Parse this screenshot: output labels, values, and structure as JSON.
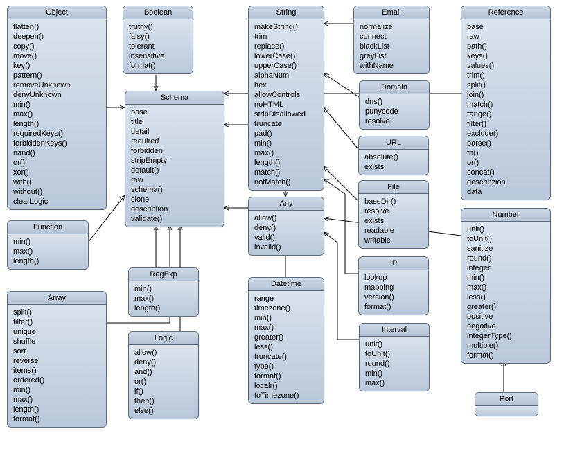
{
  "boxes": {
    "object": {
      "title": "Object",
      "items": [
        "flatten()",
        "deepen()",
        "copy()",
        "move()",
        "key()",
        "pattern()",
        "removeUnknown",
        "denyUnknown",
        "min()",
        "max()",
        "length()",
        "requiredKeys()",
        "forbiddenKeys()",
        "nand()",
        "or()",
        "xor()",
        "with()",
        "without()",
        "clearLogic"
      ]
    },
    "function": {
      "title": "Function",
      "items": [
        "min()",
        "max()",
        "length()"
      ]
    },
    "array": {
      "title": "Array",
      "items": [
        "split()",
        "filter()",
        "unique",
        "shuffle",
        "sort",
        "reverse",
        "items()",
        "ordered()",
        "min()",
        "max()",
        "length()",
        "format()"
      ]
    },
    "boolean": {
      "title": "Boolean",
      "items": [
        "truthy()",
        "falsy()",
        "tolerant",
        "insensitive",
        "format()"
      ]
    },
    "schema": {
      "title": "Schema",
      "items": [
        "base",
        "title",
        "detail",
        "required",
        "forbidden",
        "stripEmpty",
        "default()",
        "raw",
        "schema()",
        "clone",
        "description",
        "validate()"
      ]
    },
    "regexp": {
      "title": "RegExp",
      "items": [
        "min()",
        "max()",
        "length()"
      ]
    },
    "logic": {
      "title": "Logic",
      "items": [
        "allow()",
        "deny()",
        "and()",
        "or()",
        "if()",
        "then()",
        "else()"
      ]
    },
    "string": {
      "title": "String",
      "items": [
        "makeString()",
        "trim",
        "replace()",
        "lowerCase()",
        "upperCase()",
        "alphaNum",
        "hex",
        "allowControls",
        "noHTML",
        "stripDisallowed",
        "truncate",
        "pad()",
        "min()",
        "max()",
        "length()",
        "match()",
        "notMatch()"
      ]
    },
    "any": {
      "title": "Any",
      "items": [
        "allow()",
        "deny()",
        "valid()",
        "invalid()"
      ]
    },
    "datetime": {
      "title": "Datetime",
      "items": [
        "range",
        "timezone()",
        "min()",
        "max()",
        "greater()",
        "less()",
        "truncate()",
        "type()",
        "format()",
        "localr()",
        "toTimezone()"
      ]
    },
    "email": {
      "title": "Email",
      "items": [
        "normalize",
        "connect",
        "blackList",
        "greyList",
        "withName"
      ]
    },
    "domain": {
      "title": "Domain",
      "items": [
        "dns()",
        "punycode",
        "resolve"
      ]
    },
    "url": {
      "title": "URL",
      "items": [
        "absolute()",
        "exists"
      ]
    },
    "file": {
      "title": "File",
      "items": [
        "baseDir()",
        "resolve",
        "exists",
        "readable",
        "writable"
      ]
    },
    "ip": {
      "title": "IP",
      "items": [
        "lookup",
        "mapping",
        "version()",
        "format()"
      ]
    },
    "interval": {
      "title": "Interval",
      "items": [
        "unit()",
        "toUnit()",
        "round()",
        "min()",
        "max()"
      ]
    },
    "reference": {
      "title": "Reference",
      "items": [
        "base",
        "raw",
        "path()",
        "keys()",
        "values()",
        "trim()",
        "split()",
        "join()",
        "match()",
        "range()",
        "filter()",
        "exclude()",
        "parse()",
        "fn()",
        "or()",
        "concat()",
        "descripzion",
        "data"
      ]
    },
    "number": {
      "title": "Number",
      "items": [
        "unit()",
        "toUnit()",
        "sanitize",
        "round()",
        "integer",
        "min()",
        "max()",
        "less()",
        "greater()",
        "positive",
        "negative",
        "integerType()",
        "multiple()",
        "format()"
      ]
    },
    "port": {
      "title": "Port",
      "items": []
    }
  },
  "edges": [
    {
      "from": "object",
      "to": "schema"
    },
    {
      "from": "function",
      "to": "schema"
    },
    {
      "from": "array",
      "to": "schema"
    },
    {
      "from": "boolean",
      "to": "schema"
    },
    {
      "from": "regexp",
      "to": "schema"
    },
    {
      "from": "logic",
      "to": "schema"
    },
    {
      "from": "string",
      "to": "schema"
    },
    {
      "from": "any",
      "to": "schema"
    },
    {
      "from": "email",
      "to": "string"
    },
    {
      "from": "domain",
      "to": "string"
    },
    {
      "from": "url",
      "to": "string"
    },
    {
      "from": "file",
      "to": "string"
    },
    {
      "from": "ip",
      "to": "string"
    },
    {
      "from": "string",
      "to": "any"
    },
    {
      "from": "datetime",
      "to": "any"
    },
    {
      "from": "interval",
      "to": "any"
    },
    {
      "from": "number",
      "to": "any"
    },
    {
      "from": "port",
      "to": "number"
    },
    {
      "from": "reference",
      "to": "schema"
    }
  ],
  "colors": {
    "border": "#5b6b7c",
    "fillTop": "#cfd9e6",
    "fillBottom": "#b4c3d6"
  }
}
